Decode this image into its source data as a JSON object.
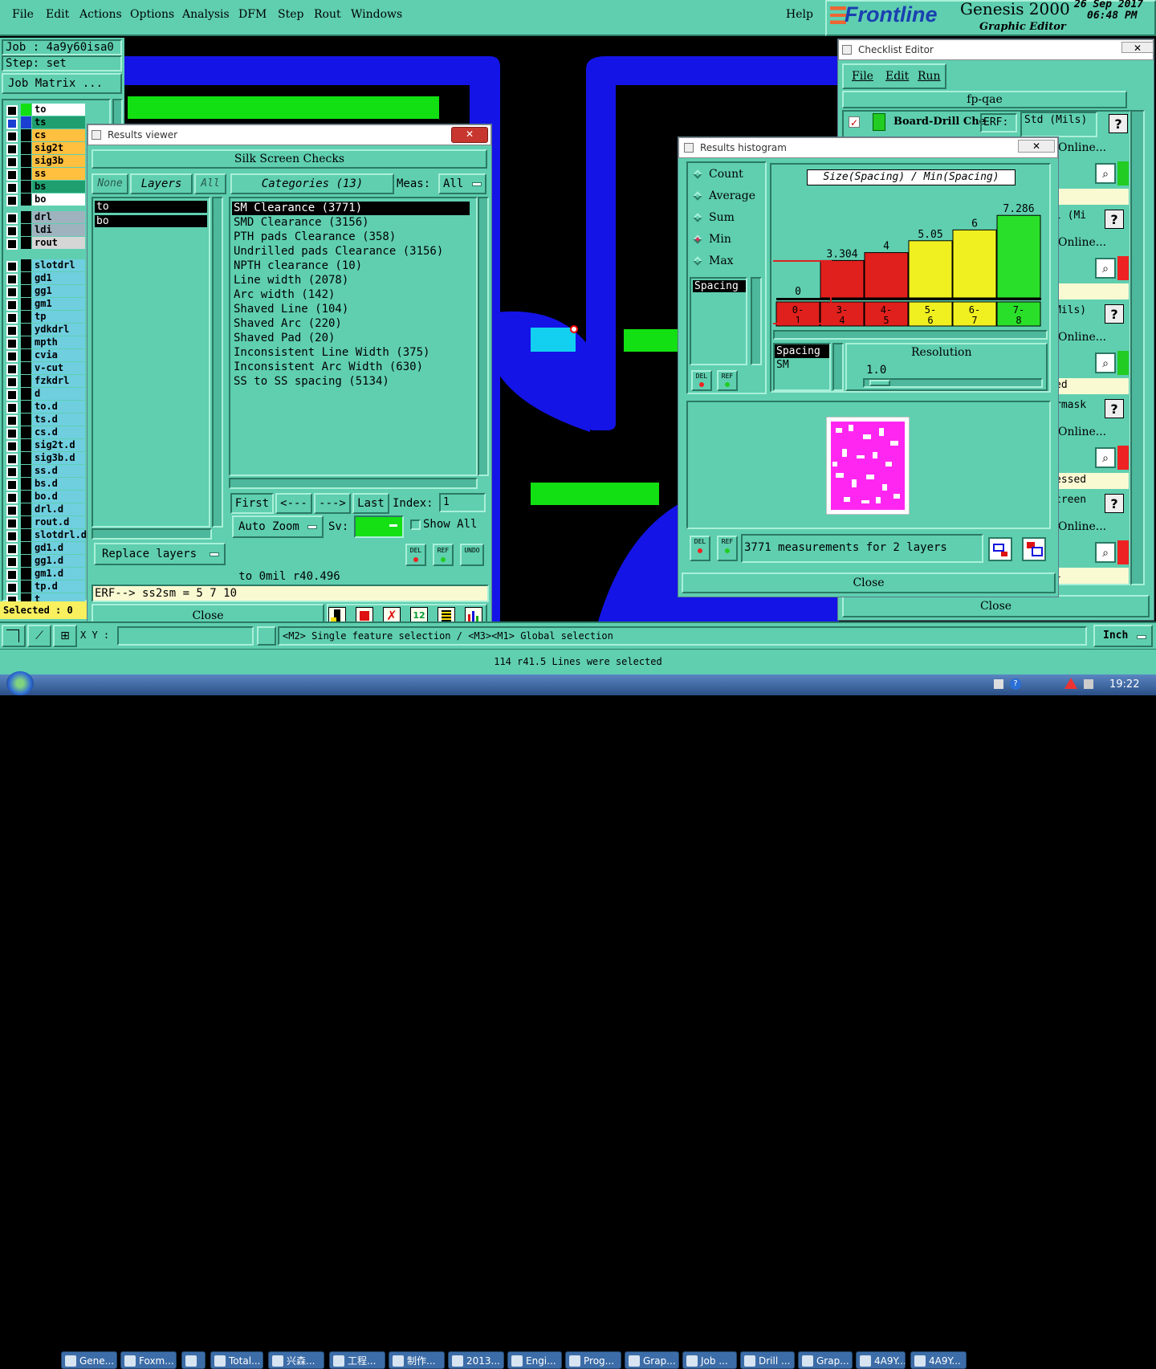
{
  "menubar": {
    "items": [
      "File",
      "Edit",
      "Actions",
      "Options",
      "Analysis",
      "DFM",
      "Step",
      "Rout",
      "Windows"
    ],
    "help": "Help",
    "brand": "Frontline",
    "product": "Genesis 2000",
    "subtitle": "Graphic Editor",
    "date": "26 Sep 2017",
    "time": "06:48 PM"
  },
  "job": {
    "job_label": "Job : 4a9y60isa0",
    "step_label": "Step: set",
    "matrix_button": "Job Matrix ..."
  },
  "layers": [
    {
      "name": "to",
      "color": "#ffffff",
      "box": "#000"
    },
    {
      "name": "ts",
      "color": "#1f9f6f",
      "box": "#1b3fd0"
    },
    {
      "name": "cs",
      "color": "#ffbf3f",
      "box": "#000"
    },
    {
      "name": "sig2t",
      "color": "#ffbf3f",
      "box": "#000"
    },
    {
      "name": "sig3b",
      "color": "#ffbf3f",
      "box": "#000"
    },
    {
      "name": "ss",
      "color": "#ffbf3f",
      "box": "#000"
    },
    {
      "name": "bs",
      "color": "#1f9f6f",
      "box": "#000"
    },
    {
      "name": "bo",
      "color": "#ffffff",
      "box": "#000"
    },
    {
      "name": "drl",
      "color": "#9fb3bf",
      "box": "#000"
    },
    {
      "name": "ldi",
      "color": "#9fb3bf",
      "box": "#000"
    },
    {
      "name": "rout",
      "color": "#d6d6d6",
      "box": "#000"
    },
    {
      "name": "slotdrl",
      "color": "#6fcfdf",
      "box": "#000"
    },
    {
      "name": "gd1",
      "color": "#6fcfdf",
      "box": "#000"
    },
    {
      "name": "gg1",
      "color": "#6fcfdf",
      "box": "#000"
    },
    {
      "name": "gm1",
      "color": "#6fcfdf",
      "box": "#000"
    },
    {
      "name": "tp",
      "color": "#6fcfdf",
      "box": "#000"
    },
    {
      "name": "ydkdrl",
      "color": "#6fcfdf",
      "box": "#000"
    },
    {
      "name": "mpth",
      "color": "#6fcfdf",
      "box": "#000"
    },
    {
      "name": "cvia",
      "color": "#6fcfdf",
      "box": "#000"
    },
    {
      "name": "v-cut",
      "color": "#6fcfdf",
      "box": "#000"
    },
    {
      "name": "fzkdrl",
      "color": "#6fcfdf",
      "box": "#000"
    },
    {
      "name": "d",
      "color": "#6fcfdf",
      "box": "#000"
    },
    {
      "name": "to.d",
      "color": "#6fcfdf",
      "box": "#000"
    },
    {
      "name": "ts.d",
      "color": "#6fcfdf",
      "box": "#000"
    },
    {
      "name": "cs.d",
      "color": "#6fcfdf",
      "box": "#000"
    },
    {
      "name": "sig2t.d",
      "color": "#6fcfdf",
      "box": "#000"
    },
    {
      "name": "sig3b.d",
      "color": "#6fcfdf",
      "box": "#000"
    },
    {
      "name": "ss.d",
      "color": "#6fcfdf",
      "box": "#000"
    },
    {
      "name": "bs.d",
      "color": "#6fcfdf",
      "box": "#000"
    },
    {
      "name": "bo.d",
      "color": "#6fcfdf",
      "box": "#000"
    },
    {
      "name": "drl.d",
      "color": "#6fcfdf",
      "box": "#000"
    },
    {
      "name": "rout.d",
      "color": "#6fcfdf",
      "box": "#000"
    },
    {
      "name": "slotdrl.d",
      "color": "#6fcfdf",
      "box": "#000"
    },
    {
      "name": "gd1.d",
      "color": "#6fcfdf",
      "box": "#000"
    },
    {
      "name": "gg1.d",
      "color": "#6fcfdf",
      "box": "#000"
    },
    {
      "name": "gm1.d",
      "color": "#6fcfdf",
      "box": "#000"
    },
    {
      "name": "tp.d",
      "color": "#6fcfdf",
      "box": "#000"
    },
    {
      "name": "t",
      "color": "#6fcfdf",
      "box": "#000"
    }
  ],
  "selected_label": "Selected : 0",
  "results_viewer": {
    "title": "Results viewer",
    "header": "Silk Screen Checks",
    "none_btn": "None",
    "layers_btn": "Layers",
    "all_btn": "All",
    "categories_btn": "Categories (13)",
    "meas_label": "Meas:",
    "meas_value": "All",
    "layer_items": [
      "to",
      "bo"
    ],
    "categories": [
      "SM Clearance (3771)",
      "SMD Clearance (3156)",
      "PTH pads Clearance (358)",
      "Undrilled pads Clearance (3156)",
      "NPTH clearance (10)",
      "Line width (2078)",
      "Arc width (142)",
      "Shaved Line (104)",
      "Shaved Arc (220)",
      "Shaved Pad (20)",
      "Inconsistent Line Width (375)",
      "Inconsistent Arc Width (630)",
      "SS to SS spacing (5134)"
    ],
    "first_btn": "First",
    "prev_btn": "<---",
    "next_btn": "--->",
    "last_btn": "Last",
    "index_label": "Index:",
    "index_value": "1",
    "replace_layers": "Replace layers",
    "auto_zoom": "Auto Zoom",
    "sv_label": "Sv:",
    "show_all": "Show All",
    "del_label": "DEL",
    "ref_label": "REF",
    "undo_label": "UNDO",
    "status_line": "to 0mil  r40.496",
    "erf_line": "ERF--> ss2sm = 5 7 10",
    "close_btn": "Close"
  },
  "histogram": {
    "title": "Results histogram",
    "options": [
      "Count",
      "Average",
      "Sum",
      "Min",
      "Max"
    ],
    "selected_option": "Min",
    "list_item": "Spacing",
    "chart_title": "Size(Spacing) / Min(Spacing)",
    "spacing_label": "Spacing",
    "sm_label": "SM",
    "resolution_label": "Resolution",
    "resolution_value": "1.0",
    "del_label": "DEL",
    "ref_label": "REF",
    "measurements": "3771 measurements for 2 layers",
    "close_btn": "Close"
  },
  "chart_data": {
    "type": "bar",
    "title": "Size(Spacing) / Min(Spacing)",
    "categories": [
      "0-1",
      "3-4",
      "4-5",
      "5-6",
      "6-7",
      "7-8"
    ],
    "values": [
      0,
      3.304,
      4,
      5.05,
      6,
      7.286
    ],
    "value_labels": [
      "0",
      "3.304",
      "4",
      "5.05",
      "6",
      "7.286"
    ],
    "colors": [
      "#e0201c",
      "#e0201c",
      "#e0201c",
      "#f0f020",
      "#f0f020",
      "#2adf2a"
    ],
    "ylim": [
      0,
      7.8
    ]
  },
  "checklist": {
    "title": "Checklist Editor",
    "menu": [
      "File",
      "Edit",
      "Run"
    ],
    "name": "fp-qae",
    "row1": "Board-Drill Che",
    "erf_label": "ERF:",
    "erf_value": "Std (Mils)",
    "online": "Online...",
    "frag_mi": "l (Mi",
    "frag_mils": "Mils)",
    "frag_ed": "ed",
    "frag_rmask": "rmask",
    "frag_essed": "essed",
    "frag_creen": "creen",
    "frag_l": "l",
    "help": "?",
    "close_btn": "Close"
  },
  "bottom": {
    "coords": "X Y :",
    "message": "<M2> Single feature selection / <M3><M1> Global selection",
    "units": "Inch",
    "status": "114 r41.5 Lines were selected"
  },
  "taskbar": {
    "items": [
      "Gene...",
      "Foxm...",
      "",
      "Total...",
      "兴森...",
      "工程...",
      "制作...",
      "2013...",
      "Engi...",
      "Prog...",
      "Grap...",
      "Job ...",
      "Drill ...",
      "Grap...",
      "4A9Y...",
      "4A9Y..."
    ],
    "clock": "19:22"
  }
}
